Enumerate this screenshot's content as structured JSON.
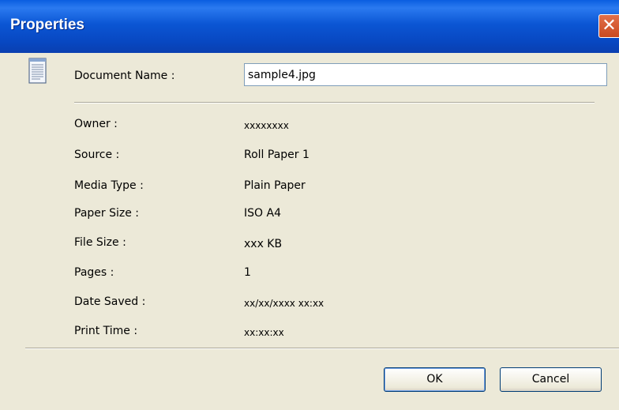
{
  "window": {
    "title": "Properties",
    "close_glyph": "✕"
  },
  "document_name": {
    "label": "Document Name :",
    "value": "sample4.jpg"
  },
  "fields": [
    {
      "label": "Owner :",
      "value": "xxxxxxxx"
    },
    {
      "label": "Source :",
      "value": "Roll Paper 1"
    },
    {
      "label": "Media Type :",
      "value": "Plain Paper"
    },
    {
      "label": "Paper Size :",
      "value": "ISO A4"
    },
    {
      "label": "File Size :",
      "value": "xxx KB"
    },
    {
      "label": "Pages :",
      "value": "1"
    },
    {
      "label": "Date Saved :",
      "value": "xx/xx/xxxx xx:xx"
    },
    {
      "label": "Print Time :",
      "value": "xx:xx:xx"
    }
  ],
  "buttons": {
    "ok": "OK",
    "cancel": "Cancel"
  },
  "icons": {
    "document": "document-icon",
    "close": "close-icon"
  },
  "colors": {
    "titlebar": "#0a56d4",
    "close": "#d8582c",
    "dialog_bg": "#ece9d8"
  }
}
